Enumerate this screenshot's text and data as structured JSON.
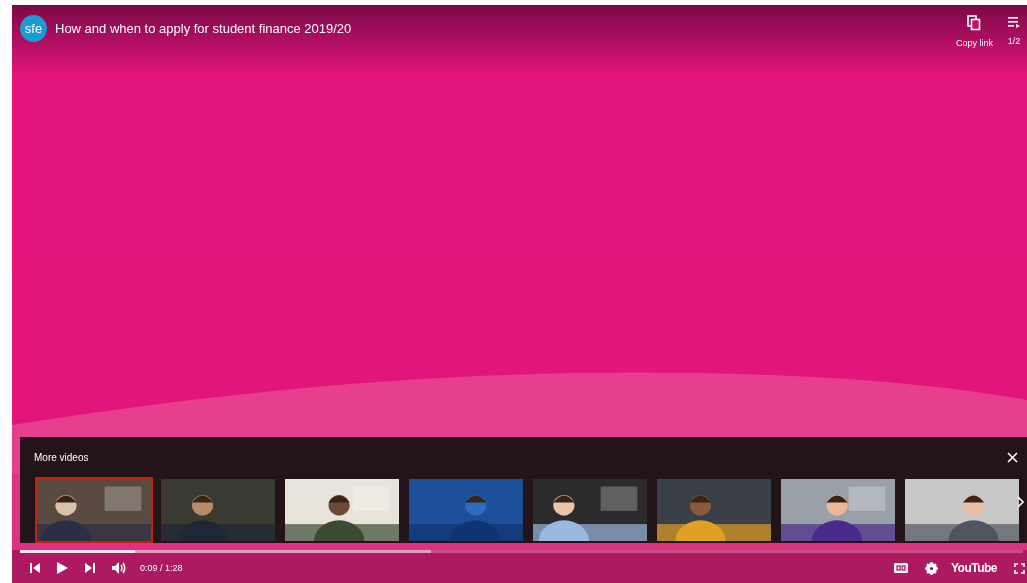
{
  "player": {
    "avatar": "sfe",
    "title": "How and when to apply for student finance 2019/20",
    "actions": [
      {
        "kind": "copy",
        "label": "Copy link"
      },
      {
        "kind": "playlist",
        "label": "1/2"
      }
    ]
  },
  "more_videos": {
    "heading": "More videos",
    "thumbnails": [
      {
        "selected": true
      },
      {
        "selected": false
      },
      {
        "selected": false
      },
      {
        "selected": false
      },
      {
        "selected": false
      },
      {
        "selected": false
      },
      {
        "selected": false
      },
      {
        "selected": false
      }
    ]
  },
  "controls": {
    "progress": {
      "level": 0.115
    },
    "buffer": {
      "level": 0.41
    },
    "time": "0:09 / 1:28",
    "logo": "YouTube"
  }
}
